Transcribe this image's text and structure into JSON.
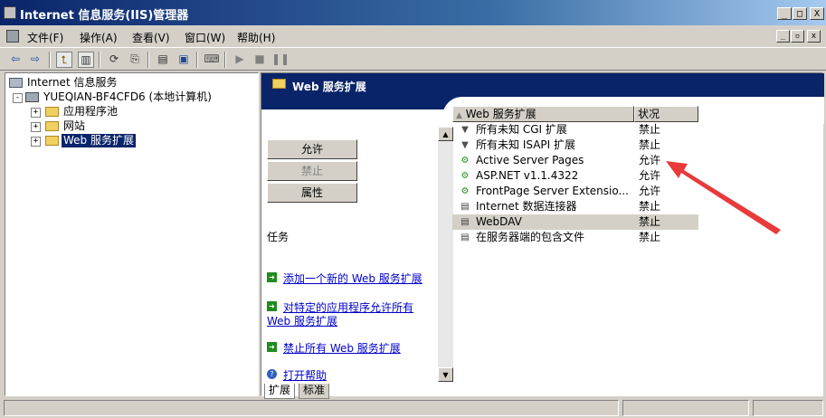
{
  "window": {
    "title": "Internet 信息服务(IIS)管理器",
    "caption_buttons": [
      "_",
      "□",
      "X"
    ],
    "mdi_buttons": [
      "_",
      "▫",
      "x"
    ]
  },
  "menu": [
    "文件(F)",
    "操作(A)",
    "查看(V)",
    "窗口(W)",
    "帮助(H)"
  ],
  "toolbar": {
    "icons": [
      "back-icon",
      "forward-icon",
      "up-folder-icon",
      "show-tree-icon",
      "refresh-icon",
      "export-icon",
      "properties-icon",
      "view-icon",
      "computer-icon",
      "play-icon",
      "stop-icon",
      "pause-icon"
    ]
  },
  "tree": {
    "root": "Internet 信息服务",
    "server": "YUEQIAN-BF4CFD6 (本地计算机)",
    "children": [
      "应用程序池",
      "网站",
      "Web 服务扩展"
    ]
  },
  "panel": {
    "header": "Web 服务扩展",
    "buttons": [
      "允许",
      "禁止",
      "属性"
    ],
    "tasks_label": "任务",
    "tasks": [
      {
        "text": "添加一个新的 Web 服务扩展"
      },
      {
        "text": "对特定的应用程序允许所有",
        "text2": "Web 服务扩展"
      },
      {
        "text": "禁止所有 Web 服务扩展"
      },
      {
        "text": "打开帮助"
      }
    ],
    "tabs": [
      "扩展",
      "标准"
    ]
  },
  "list": {
    "columns": [
      "Web 服务扩展",
      "状况"
    ],
    "rows": [
      {
        "name": "所有未知 CGI 扩展",
        "status": "禁止"
      },
      {
        "name": "所有未知 ISAPI 扩展",
        "status": "禁止"
      },
      {
        "name": "Active Server Pages",
        "status": "允许"
      },
      {
        "name": "ASP.NET v1.1.4322",
        "status": "允许"
      },
      {
        "name": "FrontPage Server Extensio...",
        "status": "允许"
      },
      {
        "name": "Internet 数据连接器",
        "status": "禁止"
      },
      {
        "name": "WebDAV",
        "status": "禁止"
      },
      {
        "name": "在服务器端的包含文件",
        "status": "禁止"
      }
    ]
  },
  "colors": {
    "title_bar": "#0a246a",
    "annotation_arrow": "#e83a3a",
    "link": "#0000cc"
  }
}
